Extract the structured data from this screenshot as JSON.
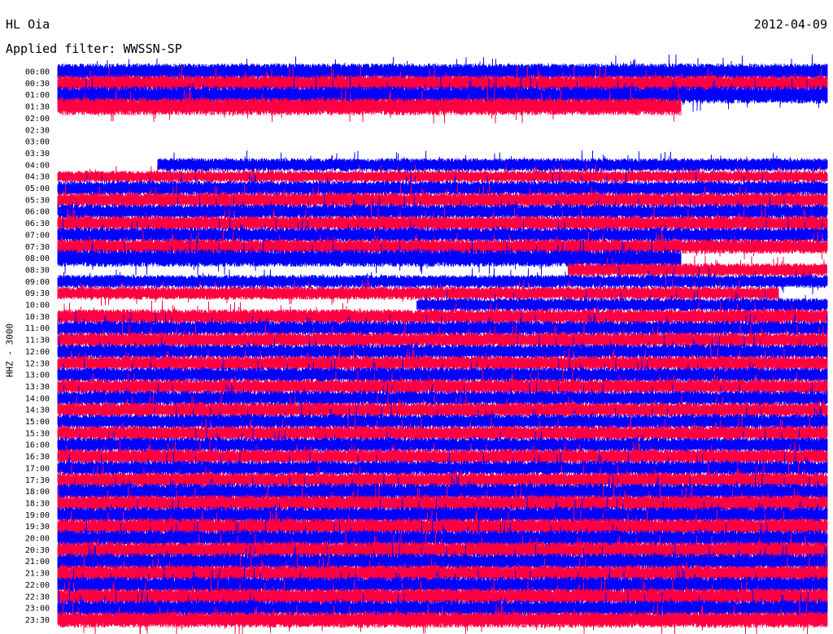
{
  "header": {
    "station": "HL Oia",
    "date": "2012-04-09",
    "filter_label": "Applied filter: WWSSN-SP"
  },
  "channel_label": "HHZ - 3000",
  "colors": {
    "even_rows": "#0000ff",
    "odd_rows": "#ff0040"
  },
  "chart_data": {
    "type": "line",
    "title": "HL Oia",
    "subtitle": "Applied filter: WWSSN-SP",
    "date": "2012-04-09",
    "ylabel": "HHZ - 3000",
    "row_labels": [
      "00:00",
      "00:30",
      "01:00",
      "01:30",
      "02:00",
      "02:30",
      "03:00",
      "03:30",
      "04:00",
      "04:30",
      "05:00",
      "05:30",
      "06:00",
      "06:30",
      "07:00",
      "07:30",
      "08:00",
      "08:30",
      "09:00",
      "09:30",
      "10:00",
      "10:30",
      "11:00",
      "11:30",
      "12:00",
      "12:30",
      "13:00",
      "13:30",
      "14:00",
      "14:30",
      "15:00",
      "15:30",
      "16:00",
      "16:30",
      "17:00",
      "17:30",
      "18:00",
      "18:30",
      "19:00",
      "19:30",
      "20:00",
      "20:30",
      "21:00",
      "21:30",
      "22:00",
      "22:30",
      "23:00",
      "23:30"
    ],
    "row_minutes": 30,
    "traces": [
      {
        "row": 0,
        "segments": [
          [
            0,
            30
          ]
        ],
        "amplitude": 1.1
      },
      {
        "row": 1,
        "segments": [
          [
            0,
            30
          ]
        ],
        "amplitude": 1.1
      },
      {
        "row": 2,
        "segments": [
          [
            0,
            30
          ]
        ],
        "amplitude": 1.2
      },
      {
        "row": 3,
        "segments": [
          [
            0,
            24.3
          ]
        ],
        "amplitude": 1.2
      },
      {
        "row": 8,
        "segments": [
          [
            3.9,
            30
          ]
        ],
        "amplitude": 0.9
      },
      {
        "row": 9,
        "segments": [
          [
            0,
            30
          ]
        ],
        "amplitude": 0.8
      },
      {
        "row": 10,
        "segments": [
          [
            0,
            30
          ]
        ],
        "amplitude": 1.0
      },
      {
        "row": 11,
        "segments": [
          [
            0,
            30
          ]
        ],
        "amplitude": 1.0
      },
      {
        "row": 12,
        "segments": [
          [
            0,
            30
          ]
        ],
        "amplitude": 1.0
      },
      {
        "row": 13,
        "segments": [
          [
            0,
            30
          ]
        ],
        "amplitude": 1.0
      },
      {
        "row": 14,
        "segments": [
          [
            0,
            30
          ]
        ],
        "amplitude": 1.0
      },
      {
        "row": 15,
        "segments": [
          [
            0,
            30
          ]
        ],
        "amplitude": 1.0
      },
      {
        "row": 16,
        "segments": [
          [
            0,
            24.3
          ]
        ],
        "amplitude": 1.2
      },
      {
        "row": 17,
        "segments": [
          [
            19.9,
            30
          ]
        ],
        "amplitude": 0.9
      },
      {
        "row": 18,
        "segments": [
          [
            0,
            30
          ]
        ],
        "amplitude": 0.9
      },
      {
        "row": 19,
        "segments": [
          [
            0,
            28.1
          ]
        ],
        "amplitude": 0.9
      },
      {
        "row": 20,
        "segments": [
          [
            14.0,
            30
          ]
        ],
        "amplitude": 0.9
      },
      {
        "row": 21,
        "segments": [
          [
            0,
            30
          ]
        ],
        "amplitude": 1.0
      },
      {
        "row": 22,
        "segments": [
          [
            0,
            30
          ]
        ],
        "amplitude": 1.0
      },
      {
        "row": 23,
        "segments": [
          [
            0,
            30
          ]
        ],
        "amplitude": 1.0
      },
      {
        "row": 24,
        "segments": [
          [
            0,
            30
          ]
        ],
        "amplitude": 1.0
      },
      {
        "row": 25,
        "segments": [
          [
            0,
            30
          ]
        ],
        "amplitude": 1.0
      },
      {
        "row": 26,
        "segments": [
          [
            0,
            30
          ]
        ],
        "amplitude": 1.0
      },
      {
        "row": 27,
        "segments": [
          [
            0,
            30
          ]
        ],
        "amplitude": 1.0
      },
      {
        "row": 28,
        "segments": [
          [
            0,
            30
          ]
        ],
        "amplitude": 1.0
      },
      {
        "row": 29,
        "segments": [
          [
            0,
            30
          ]
        ],
        "amplitude": 1.0
      },
      {
        "row": 30,
        "segments": [
          [
            0,
            30
          ]
        ],
        "amplitude": 1.0
      },
      {
        "row": 31,
        "segments": [
          [
            0,
            30
          ]
        ],
        "amplitude": 1.0
      },
      {
        "row": 32,
        "segments": [
          [
            0,
            30
          ]
        ],
        "amplitude": 1.0
      },
      {
        "row": 33,
        "segments": [
          [
            0,
            30
          ]
        ],
        "amplitude": 1.0
      },
      {
        "row": 34,
        "segments": [
          [
            0,
            30
          ]
        ],
        "amplitude": 1.0
      },
      {
        "row": 35,
        "segments": [
          [
            0,
            30
          ]
        ],
        "amplitude": 1.0
      },
      {
        "row": 36,
        "segments": [
          [
            0,
            30
          ]
        ],
        "amplitude": 1.1
      },
      {
        "row": 37,
        "segments": [
          [
            0,
            30
          ]
        ],
        "amplitude": 1.1
      },
      {
        "row": 38,
        "segments": [
          [
            0,
            30
          ]
        ],
        "amplitude": 1.1
      },
      {
        "row": 39,
        "segments": [
          [
            0,
            30
          ]
        ],
        "amplitude": 1.1
      },
      {
        "row": 40,
        "segments": [
          [
            0,
            30
          ]
        ],
        "amplitude": 1.1
      },
      {
        "row": 41,
        "segments": [
          [
            0,
            30
          ]
        ],
        "amplitude": 1.1
      },
      {
        "row": 42,
        "segments": [
          [
            0,
            30
          ]
        ],
        "amplitude": 1.1
      },
      {
        "row": 43,
        "segments": [
          [
            0,
            30
          ]
        ],
        "amplitude": 1.1
      },
      {
        "row": 44,
        "segments": [
          [
            0,
            30
          ]
        ],
        "amplitude": 1.1
      },
      {
        "row": 45,
        "segments": [
          [
            0,
            30
          ]
        ],
        "amplitude": 1.1
      },
      {
        "row": 46,
        "segments": [
          [
            0,
            30
          ]
        ],
        "amplitude": 1.1
      },
      {
        "row": 47,
        "segments": [
          [
            0,
            30
          ]
        ],
        "amplitude": 1.1
      }
    ]
  }
}
